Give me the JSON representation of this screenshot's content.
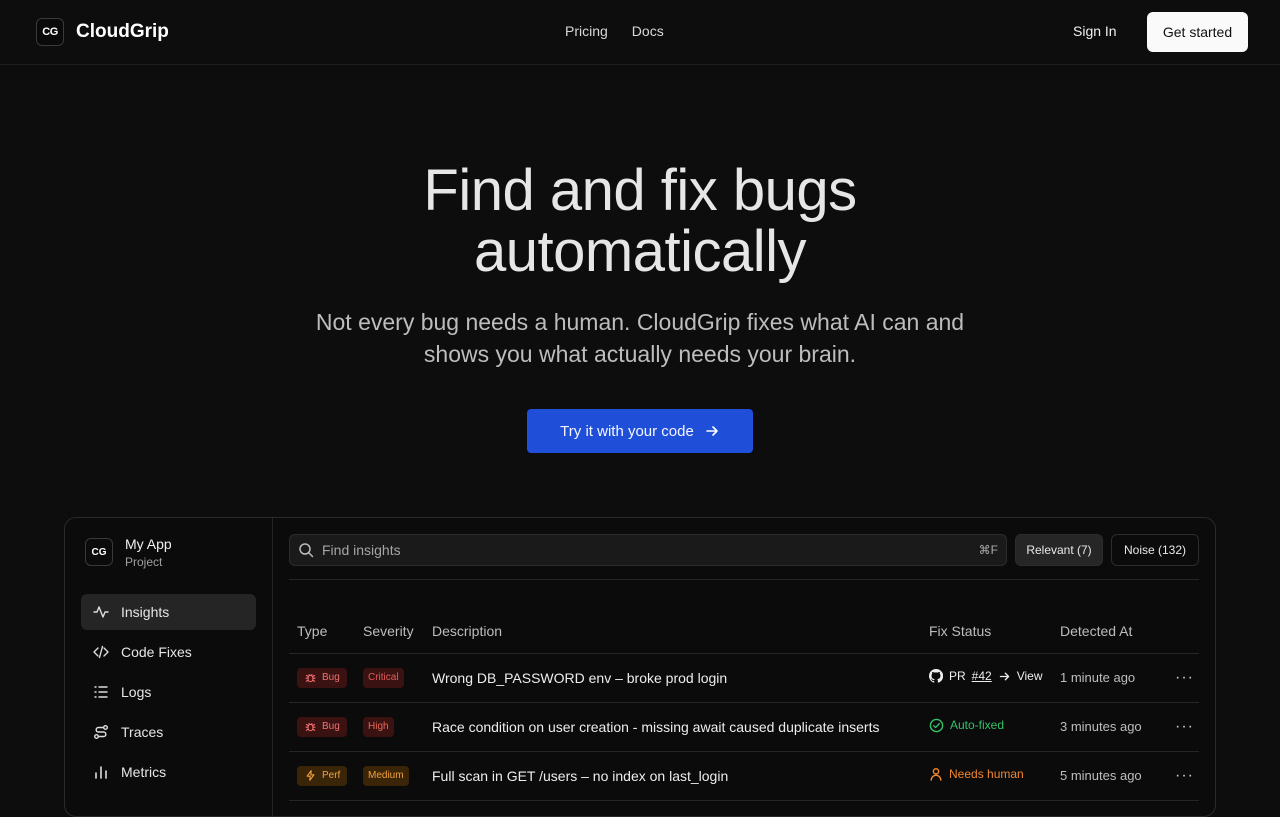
{
  "header": {
    "logo_mark": "CG",
    "brand": "CloudGrip",
    "nav": [
      "Pricing",
      "Docs"
    ],
    "signin": "Sign In",
    "get_started": "Get started"
  },
  "hero": {
    "title_line1": "Find and fix bugs",
    "title_line2": "automatically",
    "subtitle": "Not every bug needs a human. CloudGrip fixes what AI can and shows you what actually needs your brain.",
    "cta": "Try it with your code"
  },
  "app": {
    "project": {
      "logo_mark": "CG",
      "name": "My App",
      "kind": "Project"
    },
    "sidebar": [
      {
        "label": "Insights",
        "icon": "activity-icon",
        "active": true
      },
      {
        "label": "Code Fixes",
        "icon": "code-icon",
        "active": false
      },
      {
        "label": "Logs",
        "icon": "list-icon",
        "active": false
      },
      {
        "label": "Traces",
        "icon": "route-icon",
        "active": false
      },
      {
        "label": "Metrics",
        "icon": "bar-chart-icon",
        "active": false
      }
    ],
    "search": {
      "placeholder": "Find insights",
      "shortcut": "⌘F"
    },
    "filters": {
      "relevant": "Relevant (7)",
      "noise": "Noise (132)"
    },
    "table": {
      "columns": [
        "Type",
        "Severity",
        "Description",
        "Fix Status",
        "Detected At"
      ],
      "rows": [
        {
          "type": "Bug",
          "severity": "Critical",
          "description": "Wrong DB_PASSWORD env – broke prod login",
          "fix_status": {
            "kind": "pr",
            "pr_label": "PR",
            "pr_number": "#42",
            "view": "View"
          },
          "detected": "1 minute ago"
        },
        {
          "type": "Bug",
          "severity": "High",
          "description": "Race condition on user creation - missing await caused duplicate inserts",
          "fix_status": {
            "kind": "auto",
            "label": "Auto-fixed"
          },
          "detected": "3 minutes ago"
        },
        {
          "type": "Perf",
          "severity": "Medium",
          "description": "Full scan in GET /users – no index on last_login",
          "fix_status": {
            "kind": "human",
            "label": "Needs human"
          },
          "detected": "5 minutes ago"
        }
      ]
    }
  },
  "colors": {
    "accent": "#1f4fd8",
    "bug": "#f27070",
    "perf": "#f2a13c",
    "auto_fixed": "#34c26a",
    "needs_human": "#f0862e"
  }
}
